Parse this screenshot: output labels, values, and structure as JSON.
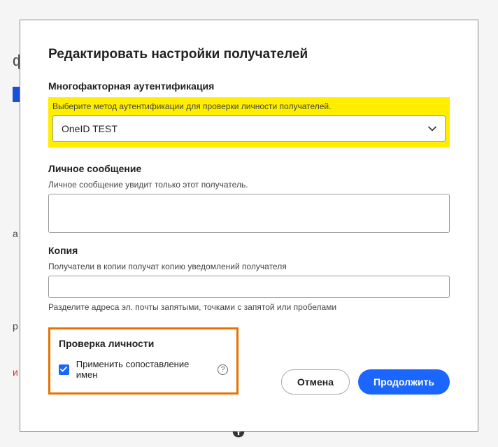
{
  "modal": {
    "title": "Редактировать настройки получателей",
    "mfa": {
      "heading": "Многофакторная аутентификация",
      "hint": "Выберите метод аутентификации для проверки личности получателей.",
      "selected": "OneID TEST"
    },
    "message": {
      "heading": "Личное сообщение",
      "hint": "Личное сообщение увидит только этот получатель.",
      "value": ""
    },
    "copy": {
      "heading": "Копия",
      "hint": "Получатели в копии получат копию уведомлений получателя",
      "value": "",
      "helper": "Разделите адреса эл. почты запятыми, точками с запятой или пробелами"
    },
    "identity": {
      "heading": "Проверка личности",
      "checkbox_label": "Применить сопоставление имен",
      "checked": true
    },
    "buttons": {
      "cancel": "Отмена",
      "continue": "Продолжить"
    }
  },
  "bg": {
    "left1": "ф",
    "left2": "а",
    "left3": "р",
    "left4": "и"
  }
}
